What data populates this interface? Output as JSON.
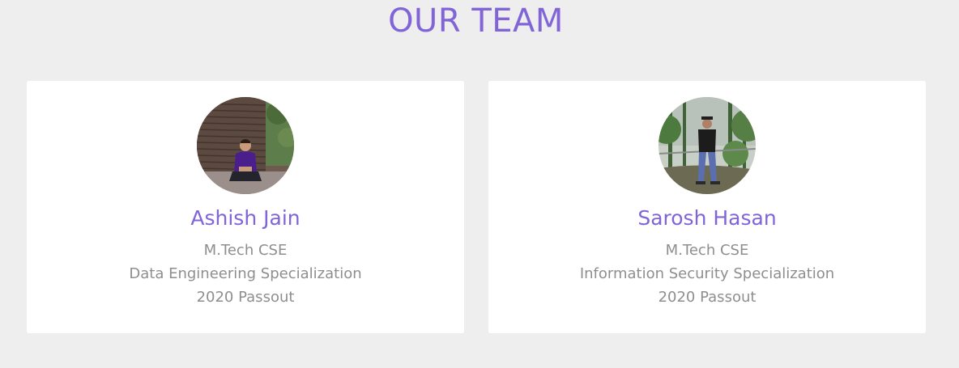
{
  "section": {
    "title": "OUR TEAM"
  },
  "members": [
    {
      "name": "Ashish Jain",
      "degree": "M.Tech CSE",
      "specialization": "Data Engineering Specialization",
      "batch": "2020 Passout"
    },
    {
      "name": "Sarosh Hasan",
      "degree": "M.Tech CSE",
      "specialization": "Information Security Specialization",
      "batch": "2020 Passout"
    }
  ],
  "colors": {
    "background": "#eeeeee",
    "accent": "#8064d8",
    "card": "#ffffff",
    "text_muted": "#8e8e8e"
  }
}
